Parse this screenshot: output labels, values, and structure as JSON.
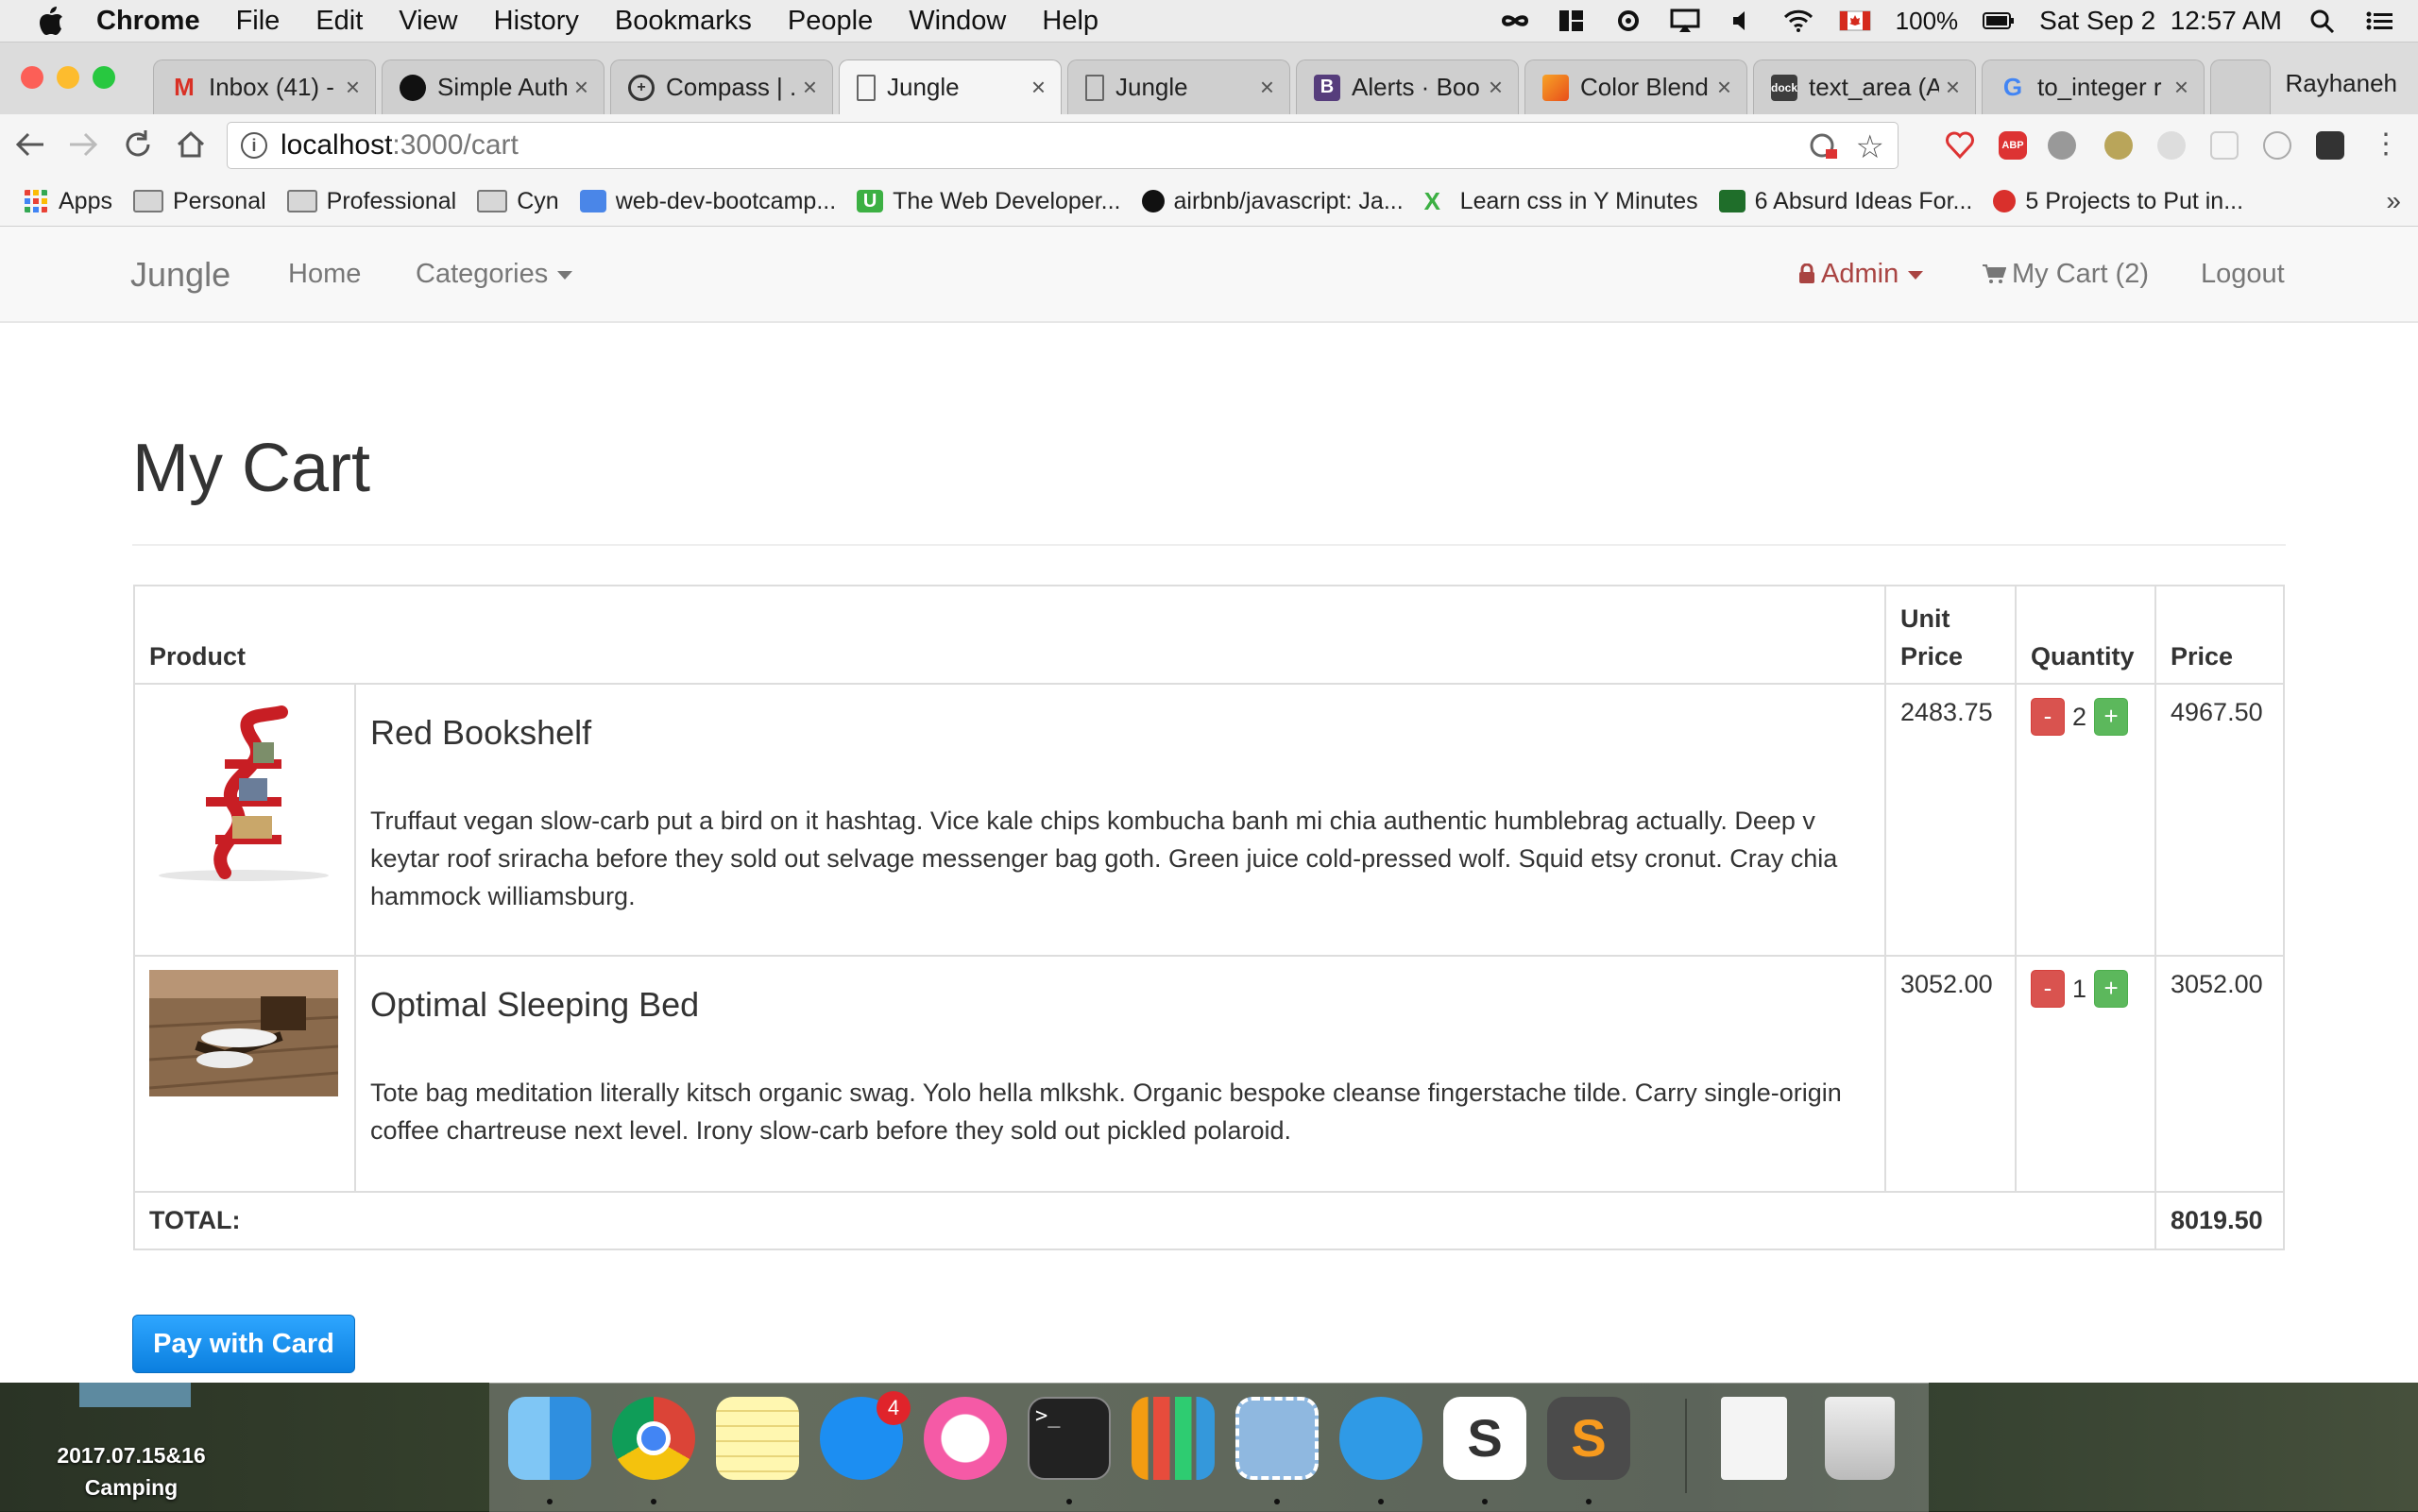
{
  "menubar": {
    "app": "Chrome",
    "items": [
      "File",
      "Edit",
      "View",
      "History",
      "Bookmarks",
      "People",
      "Window",
      "Help"
    ],
    "battery": "100%",
    "clock": "Sat Sep 2  12:57 AM"
  },
  "tabs": [
    {
      "title": "Inbox (41) -",
      "icon": "gmail-icon"
    },
    {
      "title": "Simple Auth",
      "icon": "github-icon"
    },
    {
      "title": "Compass | .",
      "icon": "compass-icon"
    },
    {
      "title": "Jungle",
      "icon": "page-icon",
      "active": true
    },
    {
      "title": "Jungle",
      "icon": "page-icon"
    },
    {
      "title": "Alerts · Boo",
      "icon": "bootstrap-icon"
    },
    {
      "title": "Color Blend",
      "icon": "color-blend-icon"
    },
    {
      "title": "text_area (A",
      "icon": "apidock-icon"
    },
    {
      "title": "to_integer r",
      "icon": "google-icon"
    }
  ],
  "profile_name": "Rayhaneh",
  "address": {
    "host": "localhost",
    "path": ":3000/cart"
  },
  "bookmarks": [
    {
      "label": "Apps",
      "icon": "apps-grid-icon"
    },
    {
      "label": "Personal",
      "icon": "folder-icon"
    },
    {
      "label": "Professional",
      "icon": "folder-icon"
    },
    {
      "label": "Cyn",
      "icon": "folder-icon"
    },
    {
      "label": "web-dev-bootcamp...",
      "icon": "bookmark-site-icon"
    },
    {
      "label": "The Web Developer...",
      "icon": "udemy-icon"
    },
    {
      "label": "airbnb/javascript: Ja...",
      "icon": "github-icon"
    },
    {
      "label": "Learn css in Y Minutes",
      "icon": "x-icon"
    },
    {
      "label": "6 Absurd Ideas For...",
      "icon": "bookmark-site-icon"
    },
    {
      "label": "5 Projects to Put in...",
      "icon": "bookmark-site-icon"
    }
  ],
  "site_nav": {
    "brand": "Jungle",
    "home": "Home",
    "categories": "Categories",
    "admin": "Admin",
    "cart": "My Cart (2)",
    "logout": "Logout"
  },
  "page_title": "My Cart",
  "cart": {
    "headers": {
      "product": "Product",
      "unit_price": "Unit Price",
      "quantity": "Quantity",
      "price": "Price"
    },
    "items": [
      {
        "name": "Red Bookshelf",
        "description": "Truffaut vegan slow-carb put a bird on it hashtag. Vice kale chips kombucha banh mi chia authentic humblebrag actually. Deep v keytar roof sriracha before they sold out selvage messenger bag goth. Green juice cold-pressed wolf. Squid etsy cronut. Cray chia hammock williamsburg.",
        "unit_price": "2483.75",
        "quantity": "2",
        "price": "4967.50"
      },
      {
        "name": "Optimal Sleeping Bed",
        "description": "Tote bag meditation literally kitsch organic swag. Yolo hella mlkshk. Organic bespoke cleanse fingerstache tilde. Carry single-origin coffee chartreuse next level. Irony slow-carb before they sold out pickled polaroid.",
        "unit_price": "3052.00",
        "quantity": "1",
        "price": "3052.00"
      }
    ],
    "minus_label": "-",
    "plus_label": "+",
    "total_label": "TOTAL:",
    "total": "8019.50"
  },
  "pay_button": "Pay with Card",
  "desktop": {
    "folder_label": "2017.07.15&16\nCamping"
  },
  "dock": {
    "app_store_badge": "4"
  },
  "colors": {
    "accent": "#2ea6ff",
    "danger": "#d9534f",
    "success": "#5cb85c",
    "admin": "#a94442"
  }
}
